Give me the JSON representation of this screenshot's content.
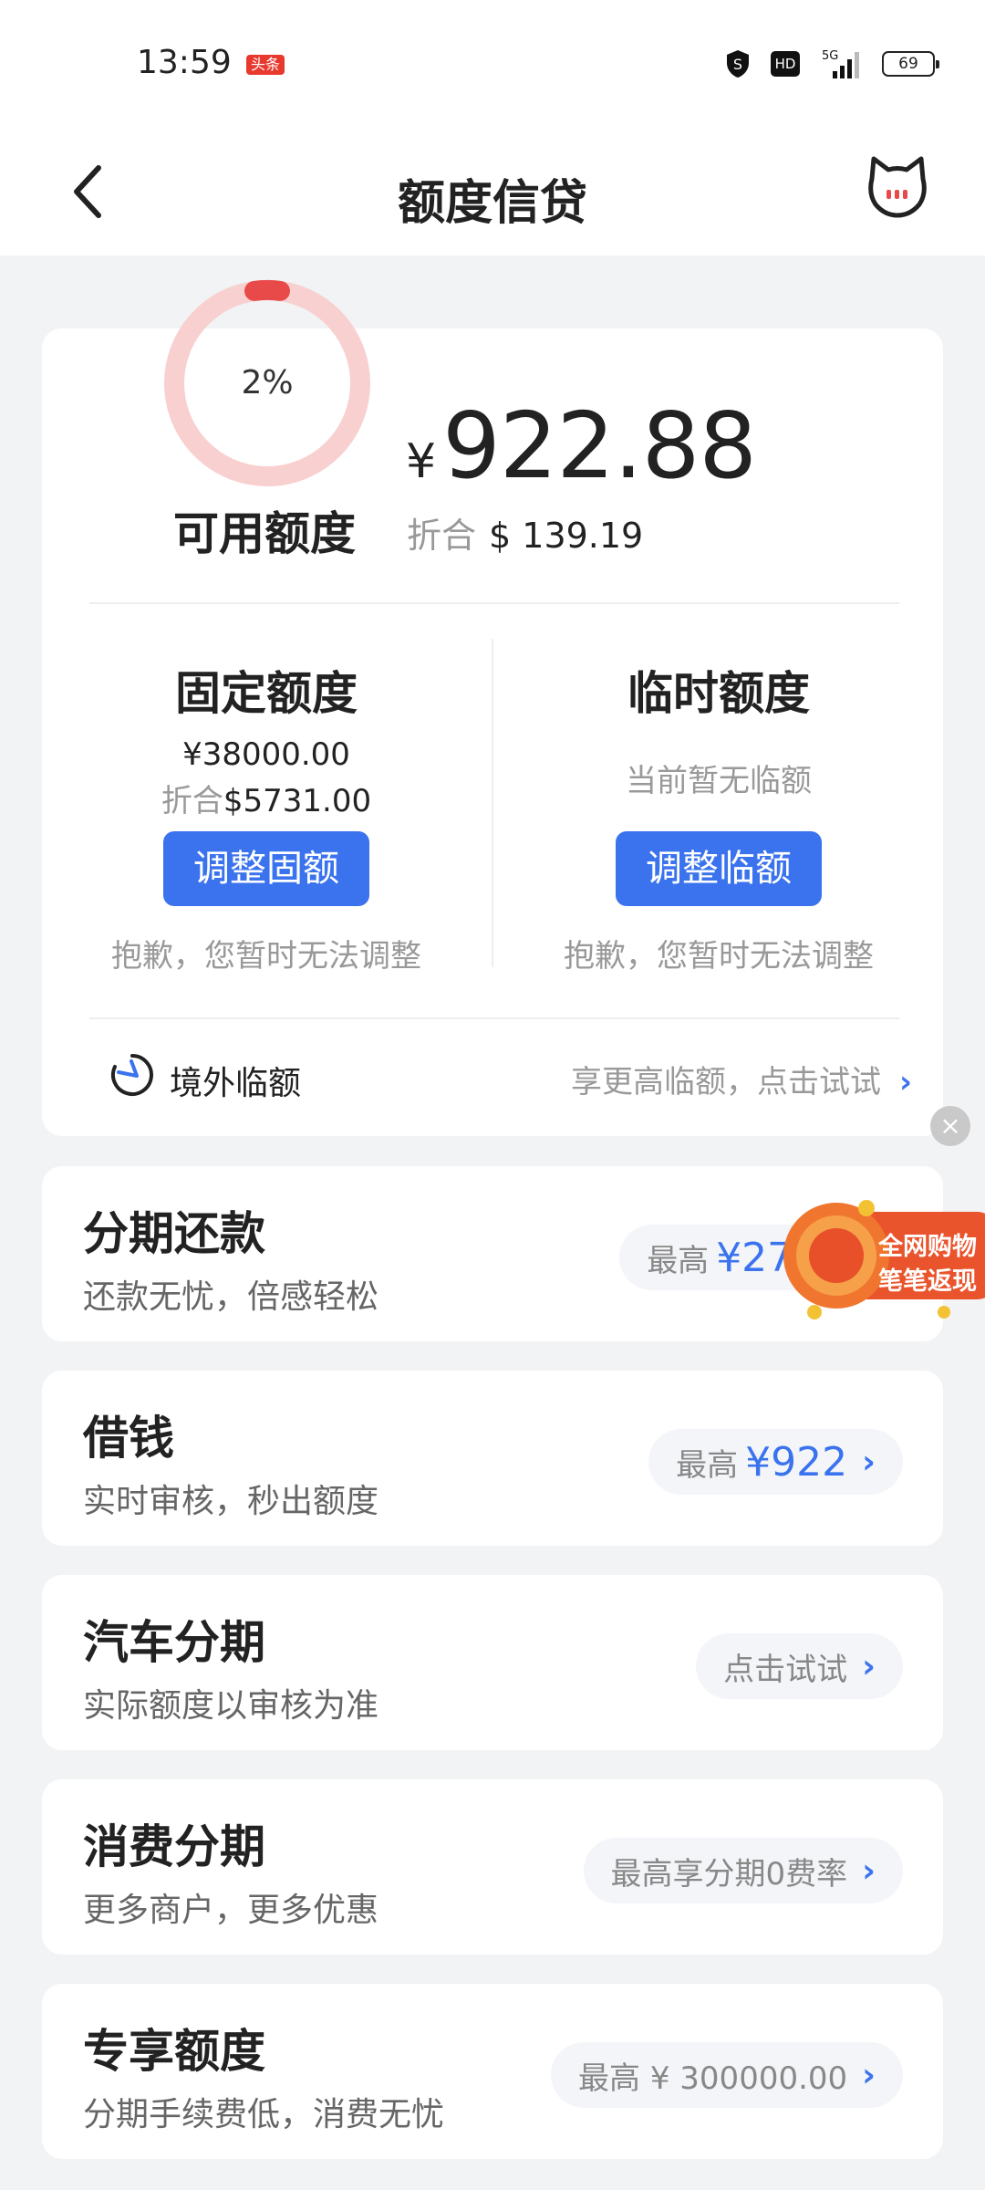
{
  "status_bar": {
    "time": "13:59",
    "news_badge": "头条",
    "hd_label": "HD",
    "network": "5G",
    "battery": "69"
  },
  "navbar": {
    "title": "额度信贷",
    "back_icon": "chevron-left-icon",
    "service_icon": "cat-face-icon"
  },
  "credit": {
    "usage_percent_label": "2%",
    "usage_percent": 2,
    "available_label": "可用额度",
    "currency_symbol": "¥",
    "available_amount": "922.88",
    "fx_prefix": "折合",
    "fx_amount": "$ 139.19",
    "ring_color": "#f8d0d0",
    "ring_accent": "#e84a4a"
  },
  "fixed": {
    "title": "固定额度",
    "amount": "¥38000.00",
    "fx_prefix": "折合",
    "fx_amount": "$5731.00",
    "button": "调整固额",
    "note": "抱歉，您暂时无法调整"
  },
  "temporary": {
    "title": "临时额度",
    "status": "当前暂无临额",
    "button": "调整临额",
    "note": "抱歉，您暂时无法调整"
  },
  "overseas": {
    "label": "境外临额",
    "action": "享更高临额，点击试试",
    "icon": "plane-clock-icon"
  },
  "products": [
    {
      "title": "分期还款",
      "subtitle": "还款无忧，倍感轻松",
      "prefix": "最高",
      "value": "¥27318"
    },
    {
      "title": "借钱",
      "subtitle": "实时审核，秒出额度",
      "prefix": "最高",
      "value": "¥922"
    },
    {
      "title": "汽车分期",
      "subtitle": "实际额度以审核为准",
      "prefix": "点击试试",
      "value": ""
    },
    {
      "title": "消费分期",
      "subtitle": "更多商户，更多优惠",
      "prefix": "最高享分期0费率",
      "value": ""
    },
    {
      "title": "专享额度",
      "subtitle": "分期手续费低，消费无忧",
      "prefix": "最高 ¥ 300000.00",
      "value": ""
    }
  ],
  "promo": {
    "line1": "全网购物",
    "line2": "笔笔返现"
  },
  "colors": {
    "accent": "#3b73ee",
    "background": "#f2f3f5",
    "card": "#ffffff",
    "muted_text": "#999999"
  }
}
